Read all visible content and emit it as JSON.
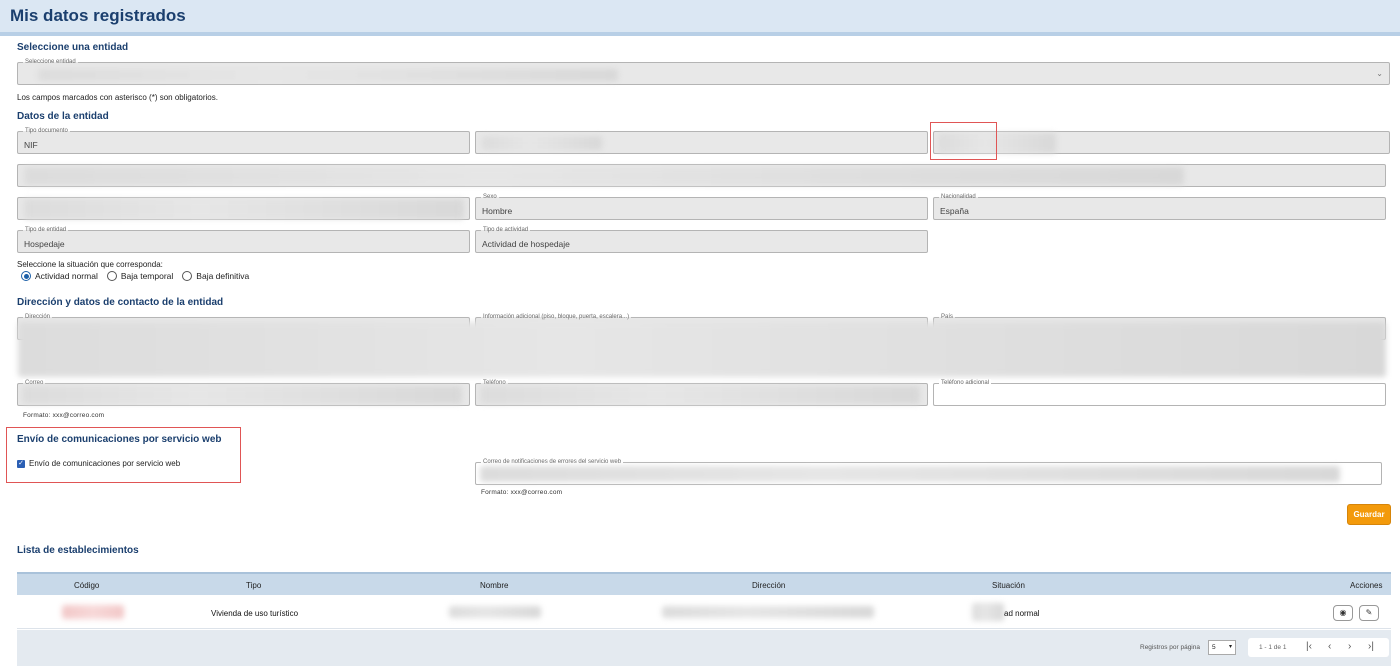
{
  "header": {
    "title": "Mis datos registrados"
  },
  "entity_select": {
    "section": "Seleccione una entidad",
    "label": "Seleccione entidad",
    "required_note": "Los campos marcados con asterisco (*) son obligatorios."
  },
  "entity_data": {
    "section": "Datos de la entidad",
    "doc_type_label": "Tipo documento",
    "doc_type_value": "NIF",
    "sex_label": "Sexo",
    "sex_value": "Hombre",
    "nationality_label": "Nacionalidad",
    "nationality_value": "España",
    "entity_type_label": "Tipo de entidad",
    "entity_type_value": "Hospedaje",
    "activity_type_label": "Tipo de actividad",
    "activity_type_value": "Actividad de hospedaje",
    "situation_prompt": "Seleccione la situación que corresponda:",
    "situations": [
      "Actividad normal",
      "Baja temporal",
      "Baja definitiva"
    ],
    "situation_selected": "Actividad normal"
  },
  "contact": {
    "section": "Dirección y datos de contacto de la entidad",
    "address_label": "Dirección",
    "extra_info_label": "Información adicional (piso, bloque, puerta, escalera...)",
    "country_label": "País",
    "email_label": "Correo",
    "phone_label": "Teléfono",
    "extra_phone_label": "Teléfono adicional",
    "email_format": "Formato: xxx@correo.com"
  },
  "webservice": {
    "section": "Envío de comunicaciones por servicio web",
    "checkbox_label": "Envío de comunicaciones por servicio web",
    "checkbox_checked": true,
    "error_email_label": "Correo de notificaciones de errores del servicio web",
    "email_format": "Formato: xxx@correo.com"
  },
  "actions": {
    "save_label": "Guardar"
  },
  "establishments": {
    "section": "Lista de establecimientos",
    "columns": [
      "Código",
      "Tipo",
      "Nombre",
      "Dirección",
      "Situación",
      "Acciones"
    ],
    "rows": [
      {
        "tipo": "Vivienda de uso turístico",
        "situacion_visible": "ad normal"
      }
    ],
    "pager": {
      "per_page_label": "Registros por página",
      "per_page_value": "5",
      "range": "1 - 1 de 1"
    }
  },
  "icons": {
    "dropdown": "chevron-down-icon",
    "view": "eye-icon",
    "edit": "pencil-icon",
    "first": "first-page-icon",
    "prev": "prev-page-icon",
    "next": "next-page-icon",
    "last": "last-page-icon"
  },
  "colors": {
    "accent": "#1b3f6e",
    "header_bg": "#dbe7f3",
    "save_button": "#f39a0b",
    "highlight_border": "#e05555",
    "table_header": "#c8d9e9"
  }
}
